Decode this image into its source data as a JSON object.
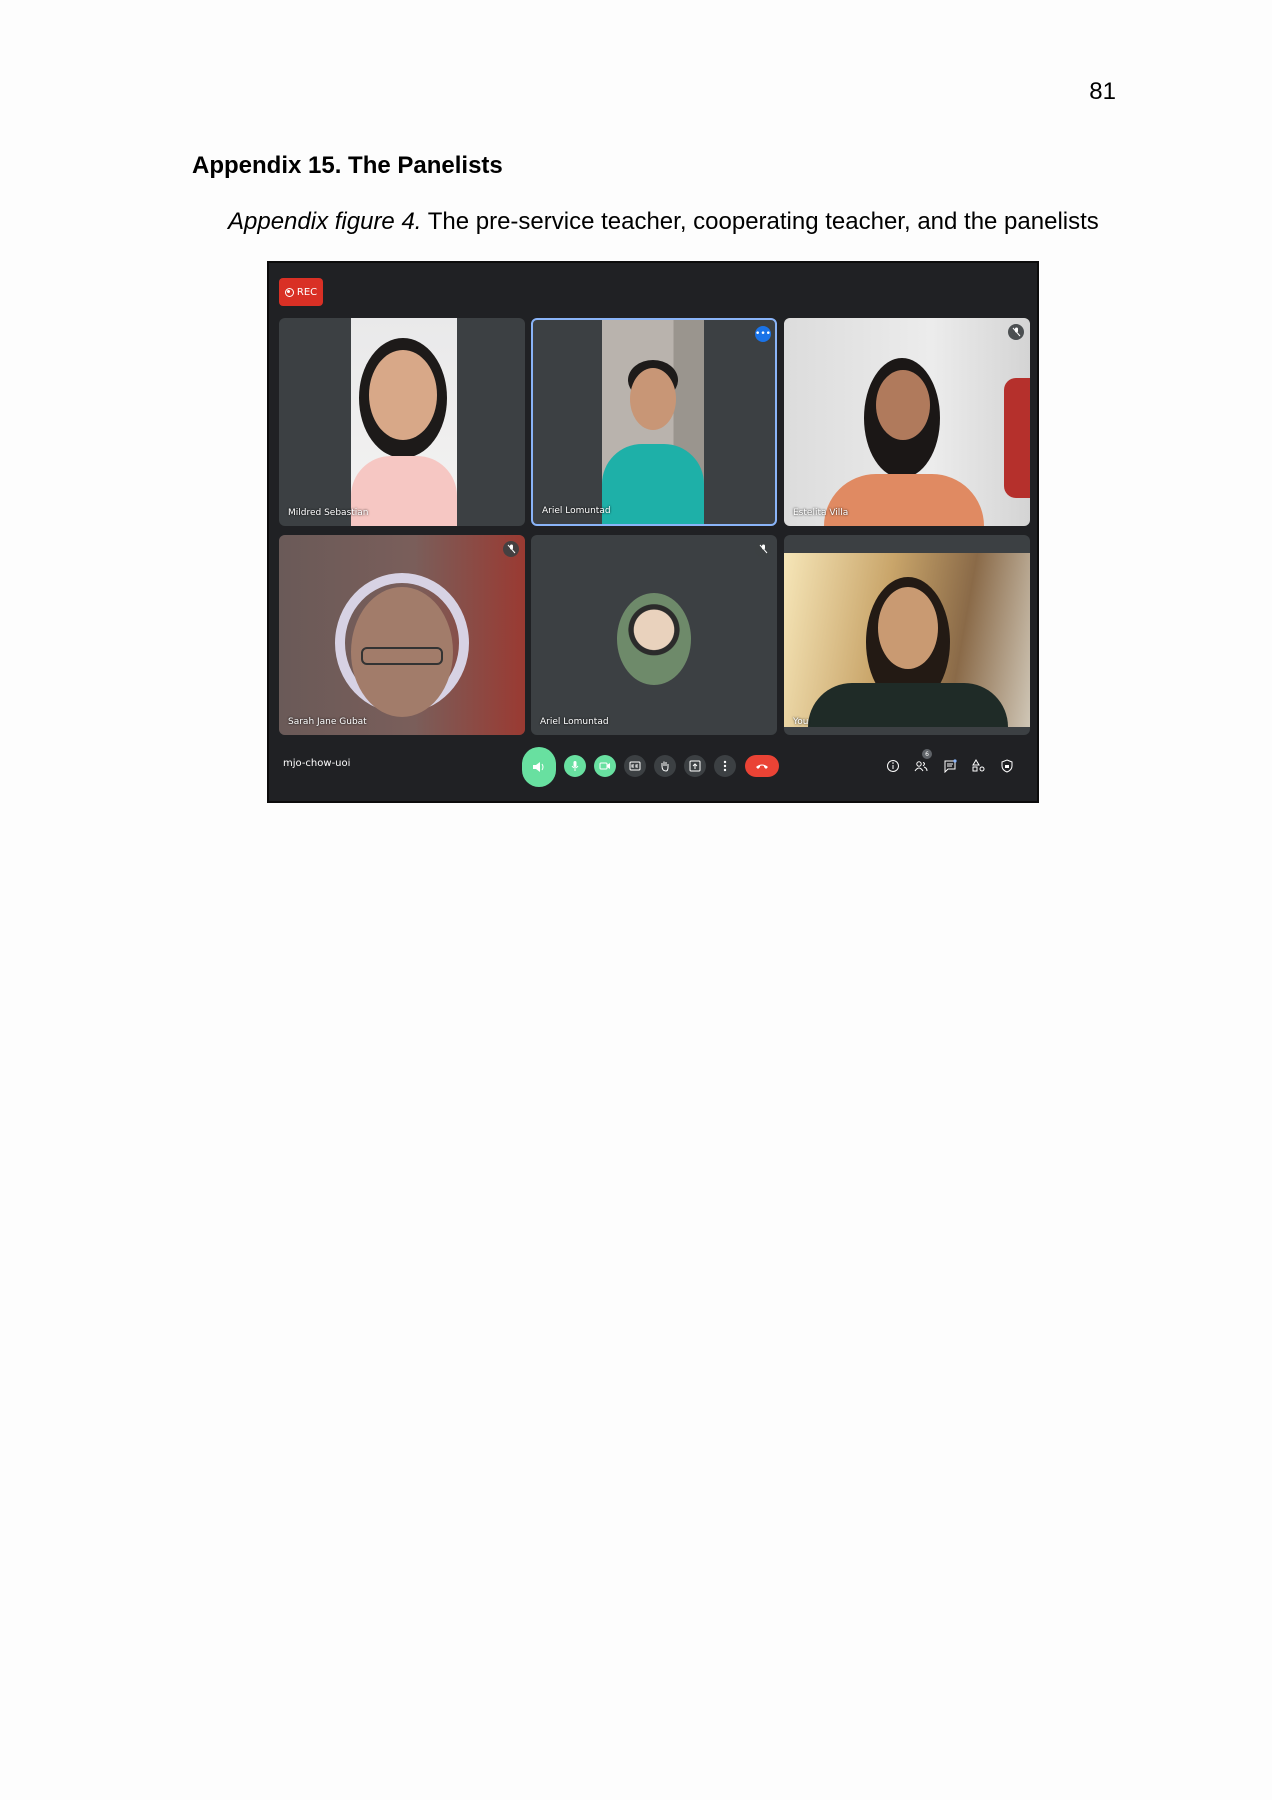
{
  "page": {
    "page_number": "81",
    "heading": "Appendix 15. The Panelists",
    "caption_italic": "Appendix figure 4.",
    "caption_text": " The pre-service teacher, cooperating teacher, and the panelists"
  },
  "meet": {
    "rec_label": "REC",
    "room_code": "mjo-chow-uoi",
    "participant_count": "6",
    "participants": [
      {
        "name": "Mildred Sebastian"
      },
      {
        "name": "Ariel Lomuntad"
      },
      {
        "name": "Estelita Villa"
      },
      {
        "name": "Sarah Jane Gubat"
      },
      {
        "name": "Ariel Lomuntad"
      },
      {
        "name": "You"
      }
    ],
    "more_options_glyph": "•••",
    "colors": {
      "background": "#202124",
      "tile": "#3c4043",
      "rec": "#d93025",
      "active_control": "#68e0a0",
      "end_call": "#ea4335",
      "speaking_outline": "#8ab4f8"
    }
  }
}
